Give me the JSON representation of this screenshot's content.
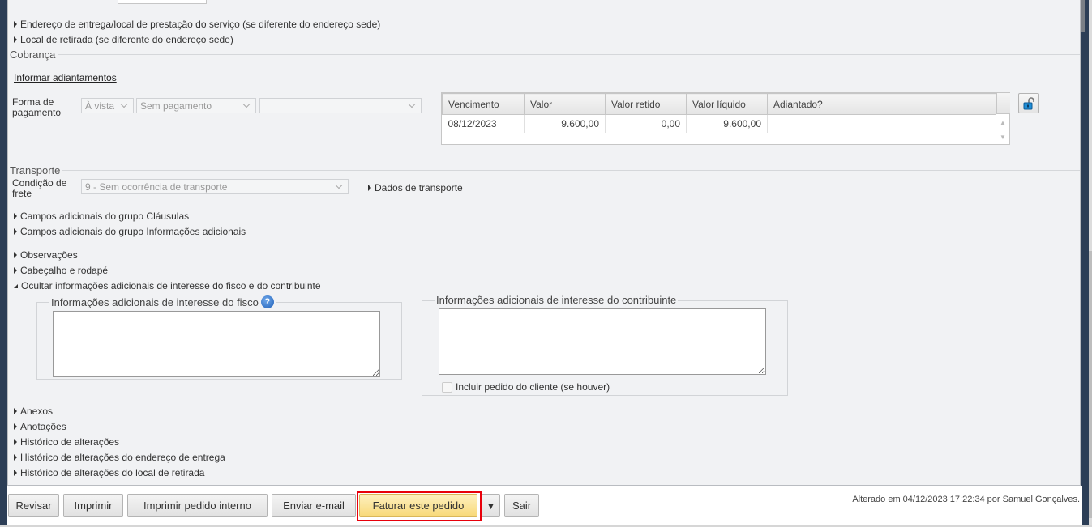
{
  "collapsibles_top": [
    {
      "label": "Endereço de entrega/local de prestação do serviço (se diferente do endereço sede)"
    },
    {
      "label": "Local de retirada (se diferente do endereço sede)"
    }
  ],
  "cobranca": {
    "title": "Cobrança",
    "link": "Informar adiantamentos",
    "forma_label": "Forma de pagamento",
    "select1": "À vista",
    "select2": "Sem pagamento",
    "select3": "",
    "table": {
      "headers": [
        "Vencimento",
        "Valor",
        "Valor retido",
        "Valor líquido",
        "Adiantado?"
      ],
      "rows": [
        [
          "08/12/2023",
          "9.600,00",
          "0,00",
          "9.600,00",
          ""
        ]
      ]
    },
    "lock_icon": "unlock-icon"
  },
  "transporte": {
    "title": "Transporte",
    "condicao_label": "Condição de frete",
    "condicao_value": "9 - Sem ocorrência de transporte",
    "dados": "Dados de transporte"
  },
  "collapsibles_mid": [
    {
      "label": "Campos adicionais do grupo Cláusulas"
    },
    {
      "label": "Campos adicionais do grupo Informações adicionais"
    },
    {
      "label": "Observações"
    },
    {
      "label": "Cabeçalho e rodapé"
    }
  ],
  "ocultar": "Ocultar informações adicionais de interesse do fisco e do contribuinte",
  "fisco": {
    "legend": "Informações adicionais de interesse do fisco",
    "value": ""
  },
  "contribuinte": {
    "legend": "Informações adicionais de interesse do contribuinte",
    "value": "",
    "checkbox": "Incluir pedido do cliente (se houver)",
    "checked": false
  },
  "collapsibles_bottom": [
    {
      "label": "Anexos"
    },
    {
      "label": "Anotações"
    },
    {
      "label": "Histórico de alterações"
    },
    {
      "label": "Histórico de alterações do endereço de entrega"
    },
    {
      "label": "Histórico de alterações do local de retirada"
    }
  ],
  "footer": {
    "buttons": {
      "revisar": "Revisar",
      "imprimir": "Imprimir",
      "imprimir_interno": "Imprimir pedido interno",
      "enviar": "Enviar e-mail",
      "faturar": "Faturar este pedido",
      "dropdown": "▼",
      "sair": "Sair"
    },
    "status": "Alterado em 04/12/2023 17:22:34 por Samuel Gonçalves.",
    "highlight_color": "#e8000b",
    "primary_color": "#fbe49a"
  }
}
